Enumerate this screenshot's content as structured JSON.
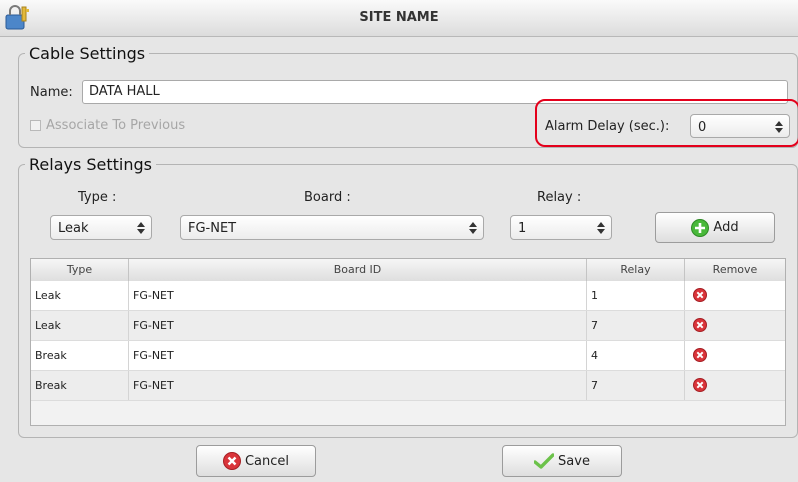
{
  "window": {
    "title": "SITE NAME",
    "icon": "lock-key-icon"
  },
  "cable_settings": {
    "legend": "Cable Settings",
    "name_label": "Name:",
    "name_value": "DATA HALL",
    "associate_label": "Associate To Previous",
    "associate_checked": false,
    "alarm_delay_label": "Alarm Delay (sec.):",
    "alarm_delay_value": "0"
  },
  "relays_settings": {
    "legend": "Relays Settings",
    "type_label": "Type :",
    "board_label": "Board :",
    "relay_label": "Relay :",
    "type_value": "Leak",
    "board_value": "FG-NET",
    "relay_value": "1",
    "add_label": "Add"
  },
  "table": {
    "columns": [
      "Type",
      "Board ID",
      "Relay",
      "Remove"
    ],
    "rows": [
      {
        "type": "Leak",
        "board_id": "FG-NET",
        "relay": "1"
      },
      {
        "type": "Leak",
        "board_id": "FG-NET",
        "relay": "7"
      },
      {
        "type": "Break",
        "board_id": "FG-NET",
        "relay": "4"
      },
      {
        "type": "Break",
        "board_id": "FG-NET",
        "relay": "7"
      }
    ]
  },
  "footer": {
    "cancel_label": "Cancel",
    "save_label": "Save"
  },
  "colors": {
    "highlight": "#e4001b",
    "remove_icon": "#d9343a",
    "add_icon": "#49b83a",
    "save_check": "#6cc24a"
  }
}
